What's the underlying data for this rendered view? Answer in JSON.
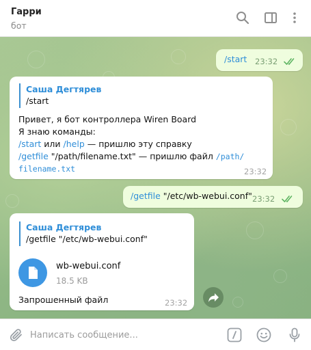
{
  "header": {
    "title": "Гарри",
    "status": "бот",
    "icons": [
      "search-icon",
      "sidebar-toggle-icon",
      "more-vert-icon"
    ]
  },
  "messages": {
    "m1": {
      "text": "/start",
      "time": "23:32"
    },
    "m2": {
      "reply_name": "Саша Дегтярев",
      "reply_text": "/start",
      "line1": "Привет, я бот контроллера Wiren Board",
      "line2": "Я знаю команды:",
      "line3_cmd1": "/start",
      "line3_or": " или ",
      "line3_cmd2": "/help",
      "line3_rest": " — пришлю эту справку",
      "line4_cmd": "/getfile",
      "line4_rest": " \"/path/filename.txt\" — пришлю файл ",
      "line4_code": "/path/",
      "line5_code": "filename.txt",
      "time": "23:32"
    },
    "m3": {
      "cmd": "/getfile",
      "rest": " \"/etc/wb-webui.conf\"",
      "time": "23:32"
    },
    "m4": {
      "reply_name": "Саша Дегтярев",
      "reply_text": "/getfile \"/etc/wb-webui.conf\"",
      "file_name": "wb-webui.conf",
      "file_size": "18.5 KB",
      "caption": "Запрошенный файл",
      "time": "23:32"
    }
  },
  "composer": {
    "placeholder": "Написать сообщение...",
    "icons": [
      "attach-icon",
      "bot-commands-icon",
      "emoji-icon",
      "microphone-icon"
    ]
  },
  "colors": {
    "accent": "#2f8ed8",
    "outgoing_bubble": "#effdde",
    "incoming_bubble": "#ffffff",
    "read_ticks": "#5fb563"
  }
}
